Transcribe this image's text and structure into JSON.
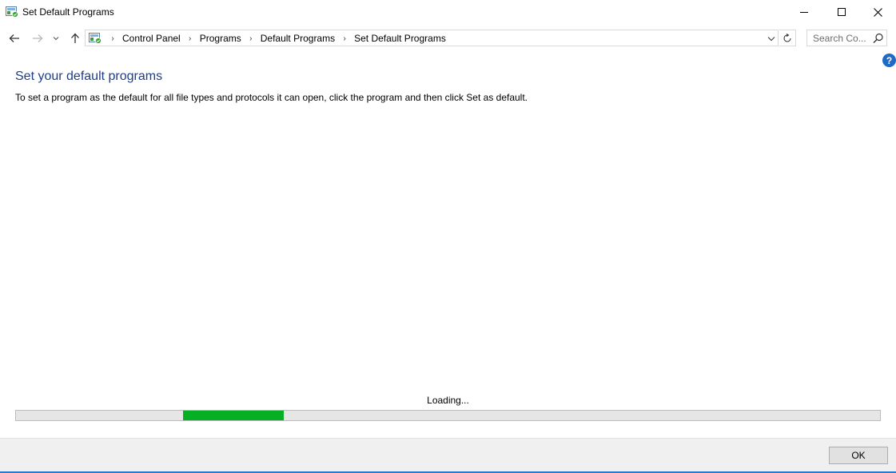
{
  "window": {
    "title": "Set Default Programs",
    "icon": "control-panel-default-programs-icon"
  },
  "nav": {
    "back_icon": "arrow-left-icon",
    "forward_icon": "arrow-right-icon",
    "recent_icon": "chevron-down-icon",
    "up_icon": "arrow-up-icon",
    "breadcrumbs": [
      "Control Panel",
      "Programs",
      "Default Programs",
      "Set Default Programs"
    ],
    "refresh_icon": "refresh-icon",
    "search": {
      "placeholder": "Search Co...",
      "icon": "search-icon"
    },
    "help_label": "?"
  },
  "main": {
    "title": "Set your default programs",
    "description": "To set a program as the default for all file types and protocols it can open, click the program and then click Set as default.",
    "loading_text": "Loading...",
    "progress": {
      "fill_start_fraction": 0.193,
      "fill_width_fraction": 0.117,
      "color": "#06b025"
    }
  },
  "footer": {
    "ok_label": "OK"
  },
  "colors": {
    "title_blue": "#1e3f87",
    "help_blue": "#1e6bc7",
    "accent_line": "#2b79d0"
  }
}
